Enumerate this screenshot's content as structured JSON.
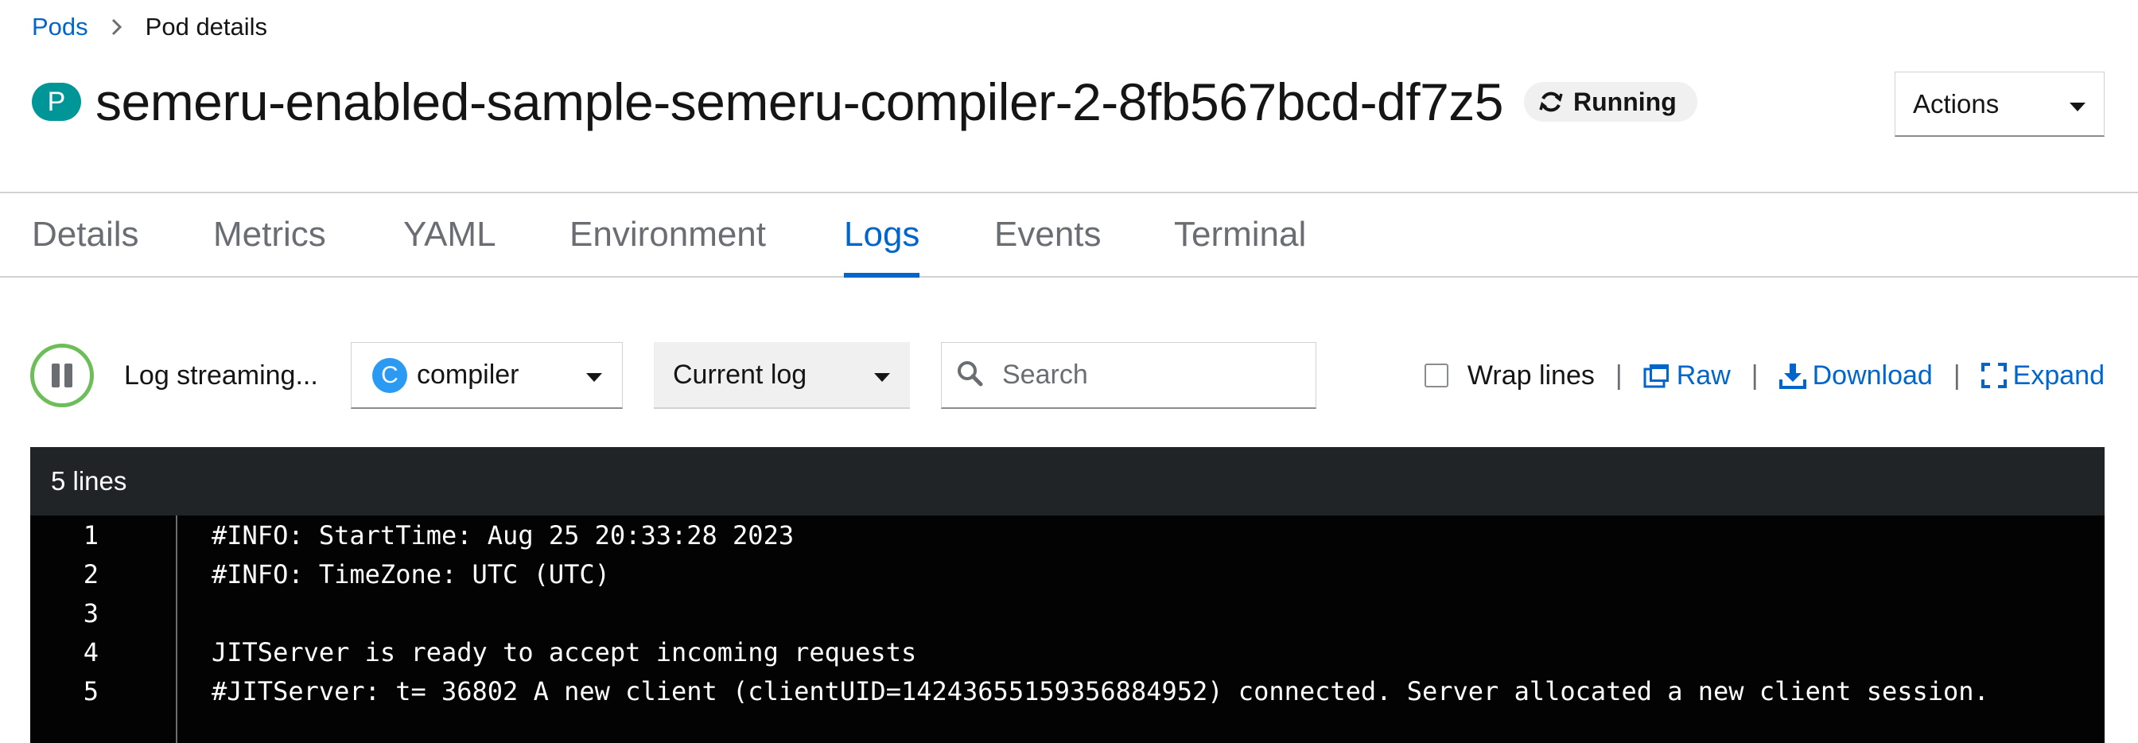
{
  "breadcrumb": {
    "parent": "Pods",
    "current": "Pod details"
  },
  "header": {
    "badge": "P",
    "pod_name": "semeru-enabled-sample-semeru-compiler-2-8fb567bcd-df7z5",
    "status": "Running",
    "actions_label": "Actions"
  },
  "tabs": [
    {
      "label": "Details",
      "active": false
    },
    {
      "label": "Metrics",
      "active": false
    },
    {
      "label": "YAML",
      "active": false
    },
    {
      "label": "Environment",
      "active": false
    },
    {
      "label": "Logs",
      "active": true
    },
    {
      "label": "Events",
      "active": false
    },
    {
      "label": "Terminal",
      "active": false
    }
  ],
  "toolbar": {
    "streaming_label": "Log streaming...",
    "container_badge": "C",
    "container_name": "compiler",
    "log_type": "Current log",
    "search_placeholder": "Search",
    "wrap_lines_label": "Wrap lines",
    "wrap_lines_checked": false,
    "raw_label": "Raw",
    "download_label": "Download",
    "expand_label": "Expand"
  },
  "log": {
    "line_count_label": "5 lines",
    "lines": [
      {
        "num": "1",
        "text": "#INFO: StartTime: Aug 25 20:33:28 2023"
      },
      {
        "num": "2",
        "text": "#INFO: TimeZone: UTC (UTC)"
      },
      {
        "num": "3",
        "text": ""
      },
      {
        "num": "4",
        "text": "JITServer is ready to accept incoming requests"
      },
      {
        "num": "5",
        "text": "#JITServer: t= 36802 A new client (clientUID=14243655159356884952) connected. Server allocated a new client session."
      }
    ]
  },
  "colors": {
    "link": "#0066cc",
    "pod_badge": "#009596",
    "container_badge": "#2b9af3",
    "streaming_ring": "#6dbe58",
    "log_bg": "#030303",
    "log_header_bg": "#212427"
  }
}
